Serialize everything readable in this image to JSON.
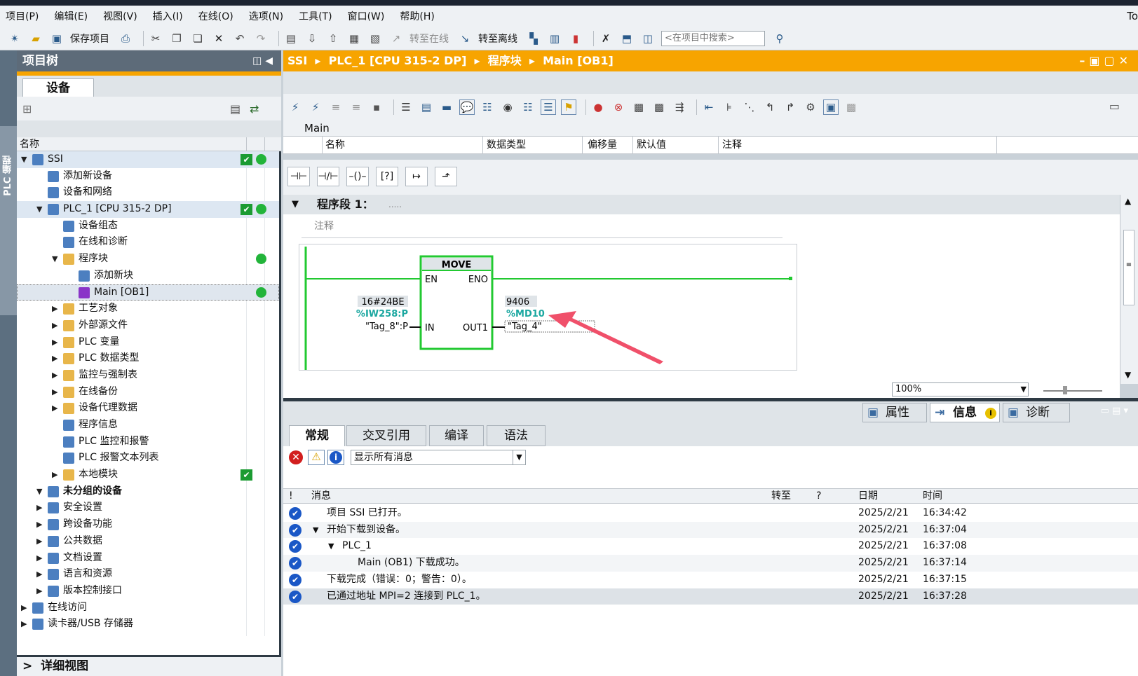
{
  "menu": [
    "项目(P)",
    "编辑(E)",
    "视图(V)",
    "插入(I)",
    "在线(O)",
    "选项(N)",
    "工具(T)",
    "窗口(W)",
    "帮助(H)"
  ],
  "menu_right": "To",
  "toolbar": {
    "save_label": "保存项目",
    "go_online": "转至在线",
    "go_offline": "转至离线",
    "search_placeholder": "<在项目中搜索>"
  },
  "left_strip_label": "PLC 编程",
  "tree": {
    "title": "项目树",
    "tab": "设备",
    "col_name": "名称",
    "items": [
      {
        "label": "SSI",
        "level": 0,
        "expanded": true,
        "check": true,
        "dot": true,
        "icon": "project-icon"
      },
      {
        "label": "添加新设备",
        "level": 1,
        "icon": "add-device-icon"
      },
      {
        "label": "设备和网络",
        "level": 1,
        "icon": "network-icon"
      },
      {
        "label": "PLC_1 [CPU 315-2 DP]",
        "level": 1,
        "expanded": true,
        "check": true,
        "dot": true,
        "icon": "plc-icon"
      },
      {
        "label": "设备组态",
        "level": 2,
        "icon": "device-config-icon"
      },
      {
        "label": "在线和诊断",
        "level": 2,
        "icon": "diagnostics-icon"
      },
      {
        "label": "程序块",
        "level": 2,
        "expanded": true,
        "dot": true,
        "icon": "folder-icon"
      },
      {
        "label": "添加新块",
        "level": 3,
        "icon": "add-block-icon"
      },
      {
        "label": "Main [OB1]",
        "level": 3,
        "dot": true,
        "icon": "ob-block-icon"
      },
      {
        "label": "工艺对象",
        "level": 2,
        "collapsed": true,
        "icon": "folder-icon"
      },
      {
        "label": "外部源文件",
        "level": 2,
        "collapsed": true,
        "icon": "folder-icon"
      },
      {
        "label": "PLC 变量",
        "level": 2,
        "collapsed": true,
        "icon": "folder-icon"
      },
      {
        "label": "PLC 数据类型",
        "level": 2,
        "collapsed": true,
        "icon": "folder-icon"
      },
      {
        "label": "监控与强制表",
        "level": 2,
        "collapsed": true,
        "icon": "folder-icon"
      },
      {
        "label": "在线备份",
        "level": 2,
        "collapsed": true,
        "icon": "folder-icon"
      },
      {
        "label": "设备代理数据",
        "level": 2,
        "collapsed": true,
        "icon": "folder-icon"
      },
      {
        "label": "程序信息",
        "level": 2,
        "icon": "info-icon"
      },
      {
        "label": "PLC 监控和报警",
        "level": 2,
        "icon": "alarm-icon"
      },
      {
        "label": "PLC 报警文本列表",
        "level": 2,
        "icon": "text-list-icon"
      },
      {
        "label": "本地模块",
        "level": 2,
        "collapsed": true,
        "check": true,
        "icon": "folder-icon"
      },
      {
        "label": "未分组的设备",
        "level": 1,
        "expanded": true,
        "bold": true,
        "icon": "ungrouped-icon"
      },
      {
        "label": "安全设置",
        "level": 1,
        "collapsed": true,
        "icon": "security-icon"
      },
      {
        "label": "跨设备功能",
        "level": 1,
        "collapsed": true,
        "icon": "cross-device-icon"
      },
      {
        "label": "公共数据",
        "level": 1,
        "collapsed": true,
        "icon": "common-data-icon"
      },
      {
        "label": "文档设置",
        "level": 1,
        "collapsed": true,
        "icon": "doc-settings-icon"
      },
      {
        "label": "语言和资源",
        "level": 1,
        "collapsed": true,
        "icon": "language-icon"
      },
      {
        "label": "版本控制接口",
        "level": 1,
        "collapsed": true,
        "icon": "version-control-icon"
      },
      {
        "label": "在线访问",
        "level": 0,
        "collapsed": true,
        "icon": "online-access-icon"
      },
      {
        "label": "读卡器/USB 存储器",
        "level": 0,
        "collapsed": true,
        "icon": "card-reader-icon"
      }
    ],
    "detail_view": "详细视图"
  },
  "editor": {
    "breadcrumb": [
      "SSI",
      "PLC_1 [CPU 315-2 DP]",
      "程序块",
      "Main [OB1]"
    ],
    "block_name": "Main",
    "iface_cols": [
      "名称",
      "数据类型",
      "偏移量",
      "默认值",
      "注释"
    ],
    "network_title": "程序段 1：",
    "network_dots": ".....",
    "comment": "注释",
    "move": {
      "title": "MOVE",
      "en": "EN",
      "eno": "ENO",
      "in": "IN",
      "out": "OUT1",
      "in_value": "16#24BE",
      "in_addr": "%IW258:P",
      "in_tag": "\"Tag_8\":P",
      "out_value": "9406",
      "out_addr": "%MD10",
      "out_tag": "\"Tag_4\""
    },
    "zoom": "100%"
  },
  "bottom": {
    "tabs": [
      "属性",
      "信息",
      "诊断"
    ],
    "subtabs": [
      "常规",
      "交叉引用",
      "编译",
      "语法"
    ],
    "filter": "显示所有消息",
    "cols": [
      "!",
      "消息",
      "转至",
      "?",
      "日期",
      "时间"
    ],
    "messages": [
      {
        "msg": "项目 SSI 已打开。",
        "date": "2025/2/21",
        "time": "16:34:42",
        "indent": 0
      },
      {
        "msg": "开始下载到设备。",
        "date": "2025/2/21",
        "time": "16:37:04",
        "indent": 0,
        "expand": true
      },
      {
        "msg": "PLC_1",
        "date": "2025/2/21",
        "time": "16:37:08",
        "indent": 1,
        "expand": true
      },
      {
        "msg": "Main (OB1) 下载成功。",
        "date": "2025/2/21",
        "time": "16:37:14",
        "indent": 2
      },
      {
        "msg": "下载完成（错误：0；警告：0）。",
        "date": "2025/2/21",
        "time": "16:37:15",
        "indent": 0
      },
      {
        "msg": "已通过地址 MPI=2 连接到 PLC_1。",
        "date": "2025/2/21",
        "time": "16:37:28",
        "indent": 0
      }
    ]
  },
  "colors": {
    "accent_orange": "#f7a400",
    "ladder_green": "#22c931",
    "status_green": "#22b43a",
    "arrow_red": "#f0506a",
    "teal": "#1aa7a0"
  }
}
